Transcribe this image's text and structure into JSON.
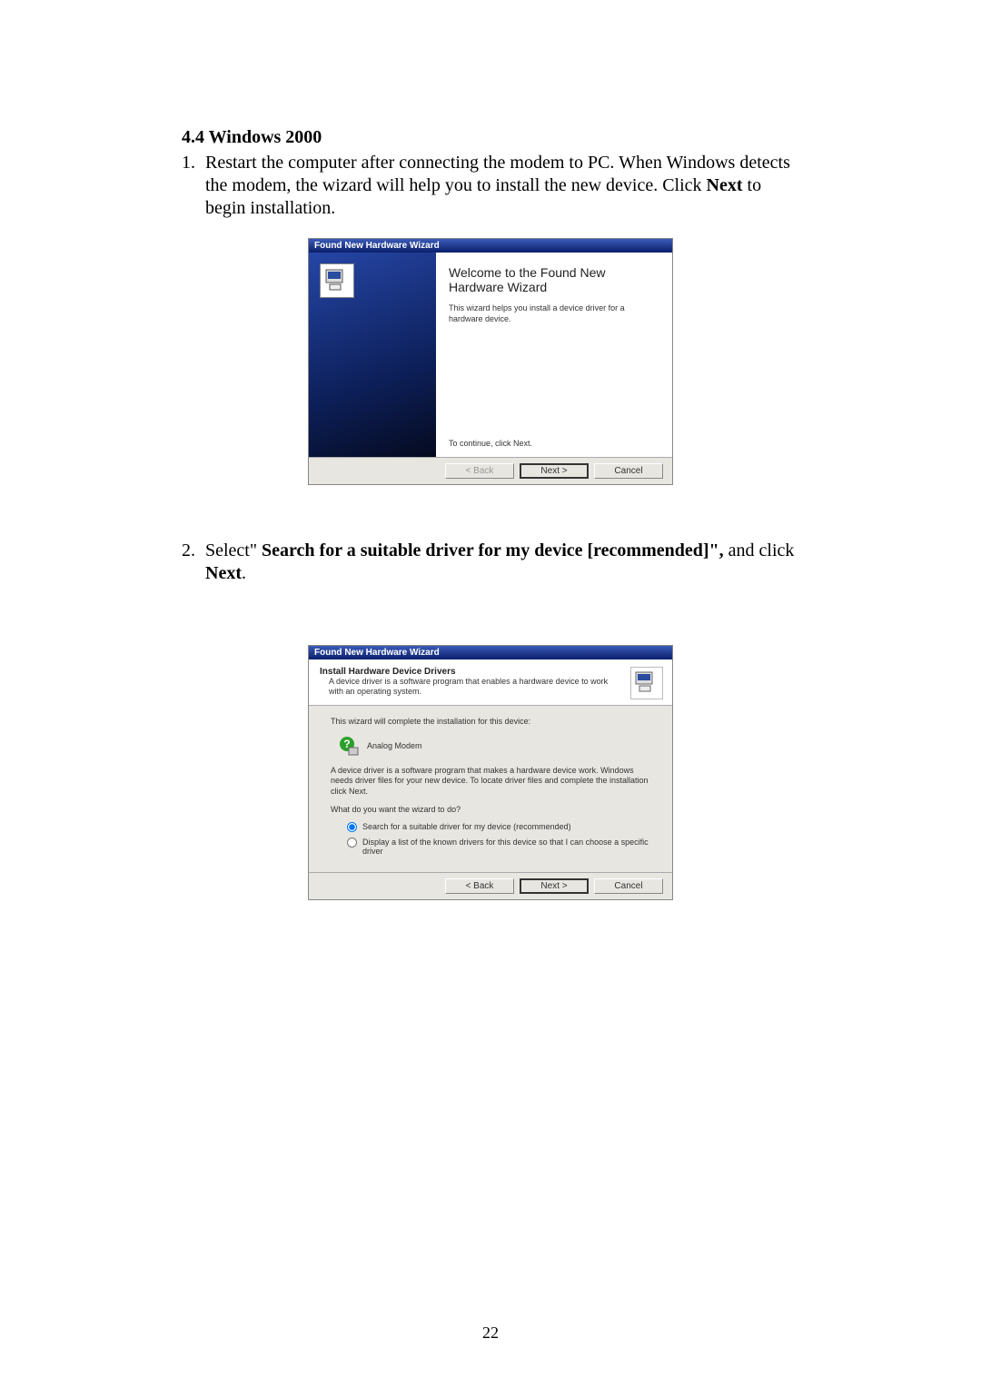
{
  "section": {
    "heading": "4.4 Windows 2000"
  },
  "steps": {
    "s1": {
      "num": "1.",
      "pre": "Restart the computer after connecting the modem to PC. When Windows detects the modem, the wizard will help you to install the new device. Click ",
      "bold1": "Next",
      "post": " to begin installation."
    },
    "s2": {
      "num": "2.",
      "pre": "Select\" ",
      "bold1": "Search for a suitable driver for my device [recommended]\", ",
      "mid": "and click ",
      "bold2": "Next",
      "post": "."
    }
  },
  "wizard1": {
    "titlebar": "Found New Hardware Wizard",
    "title": "Welcome to the Found New Hardware Wizard",
    "desc": "This wizard helps you install a device driver for a hardware device.",
    "continue": "To continue, click Next.",
    "buttons": {
      "back": "< Back",
      "next": "Next >",
      "cancel": "Cancel"
    }
  },
  "wizard2": {
    "titlebar": "Found New Hardware Wizard",
    "htitle": "Install Hardware Device Drivers",
    "hsub": "A device driver is a software program that enables a hardware device to work with an operating system.",
    "line1": "This wizard will complete the installation for this device:",
    "device_name": "Analog Modem",
    "line2": "A device driver is a software program that makes a hardware device work. Windows needs driver files for your new device. To locate driver files and complete the installation click Next.",
    "question": "What do you want the wizard to do?",
    "opt1": "Search for a suitable driver for my device (recommended)",
    "opt2": "Display a list of the known drivers for this device so that I can choose a specific driver",
    "buttons": {
      "back": "< Back",
      "next": "Next >",
      "cancel": "Cancel"
    }
  },
  "page_number": "22"
}
